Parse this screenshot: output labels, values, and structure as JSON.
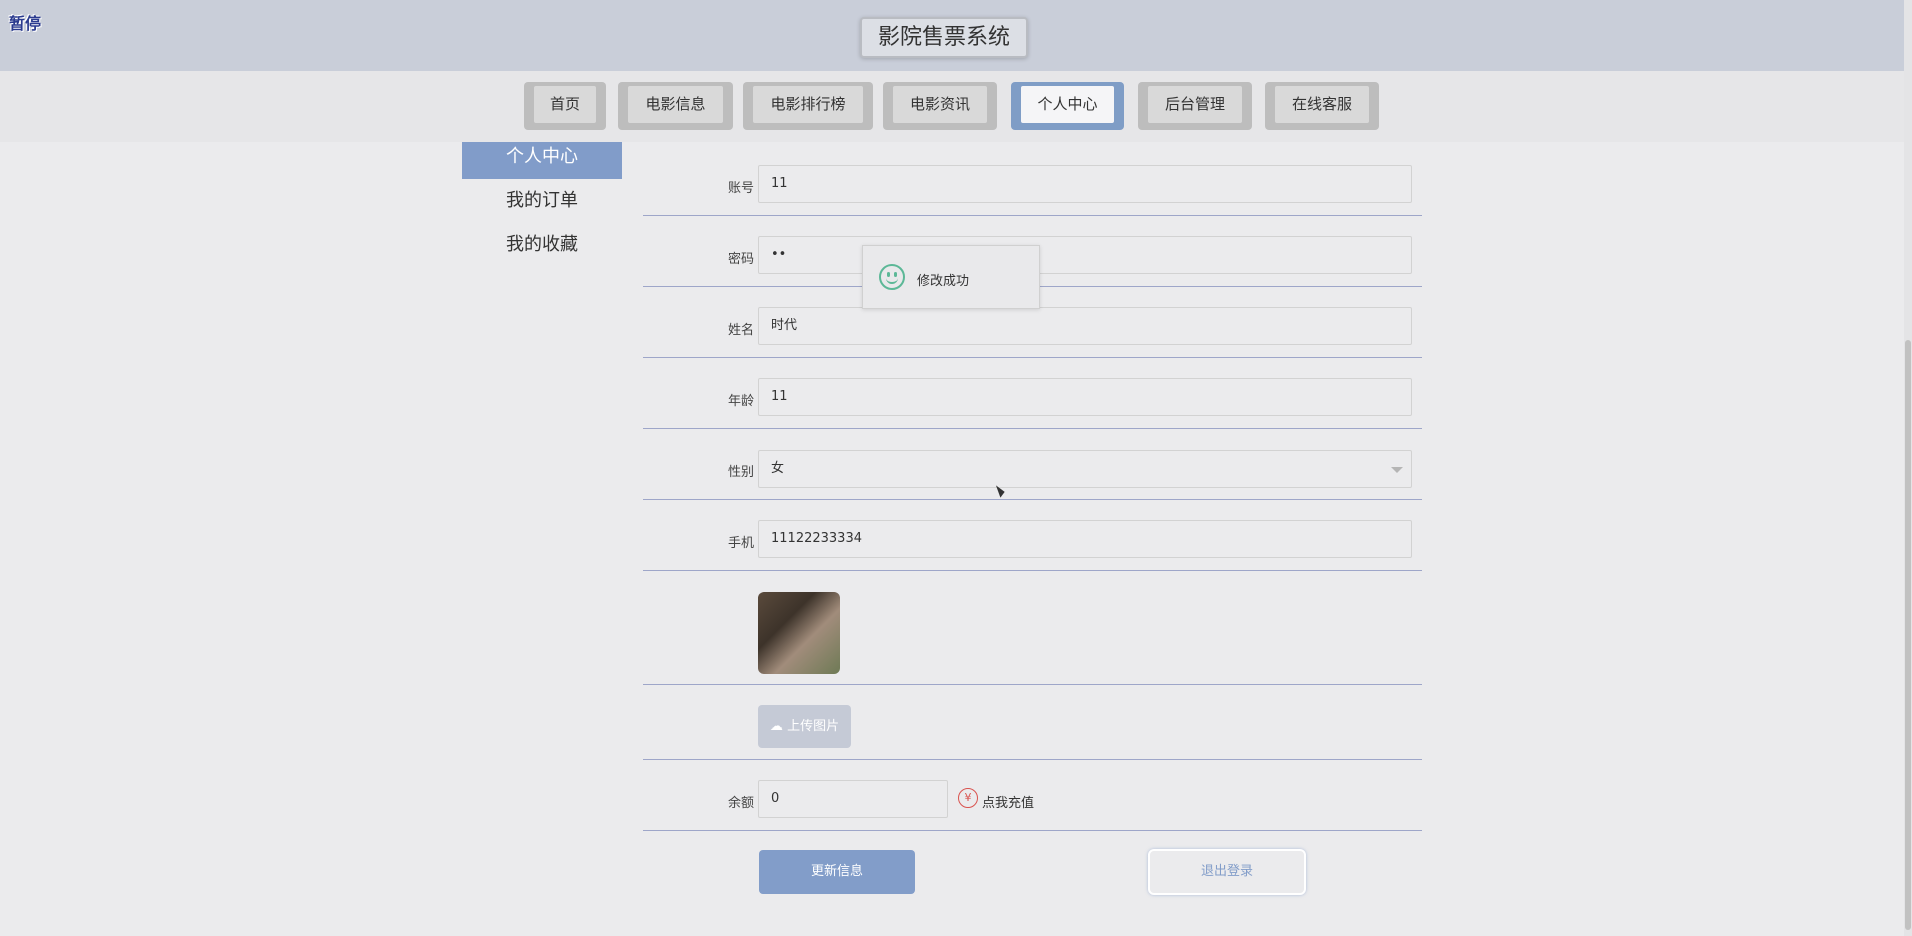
{
  "header": {
    "pause_label": "暂停",
    "title": "影院售票系统"
  },
  "nav": {
    "items": [
      "首页",
      "电影信息",
      "电影排行榜",
      "电影资讯",
      "个人中心",
      "后台管理",
      "在线客服"
    ],
    "active": "个人中心"
  },
  "sidebar": {
    "items": [
      "个人中心",
      "我的订单",
      "我的收藏"
    ],
    "active": "个人中心"
  },
  "form": {
    "account_label": "账号",
    "account_value": "11",
    "password_label": "密码",
    "password_value": "••",
    "name_label": "姓名",
    "name_value": "时代",
    "age_label": "年龄",
    "age_value": "11",
    "gender_label": "性别",
    "gender_value": "女",
    "phone_label": "手机",
    "phone_value": "11122233334",
    "upload_label": "上传图片",
    "balance_label": "余额",
    "balance_value": "0",
    "recharge_label": "点我充值",
    "update_button": "更新信息",
    "logout_button": "退出登录"
  },
  "toast": {
    "message": "修改成功"
  },
  "colors": {
    "accent": "#829dc9",
    "header_bg": "#c9ced9",
    "success": "#5cb897",
    "recharge": "#d9534f"
  }
}
